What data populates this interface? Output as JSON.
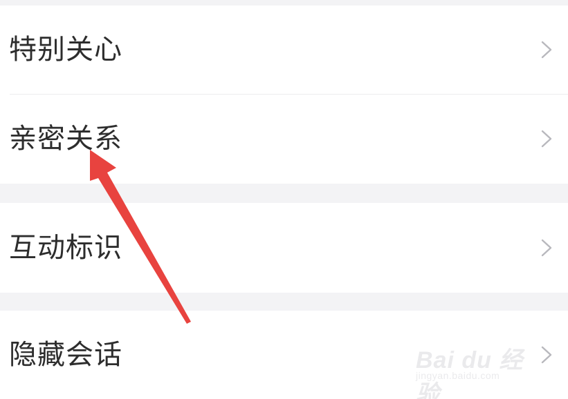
{
  "menu": {
    "groups": [
      {
        "items": [
          {
            "label": "特别关心",
            "icon": "chevron-right-icon"
          },
          {
            "label": "亲密关系",
            "icon": "chevron-right-icon"
          }
        ]
      },
      {
        "items": [
          {
            "label": "互动标识",
            "icon": "chevron-right-icon"
          }
        ]
      },
      {
        "items": [
          {
            "label": "隐藏会话",
            "icon": "chevron-right-icon"
          }
        ]
      }
    ]
  },
  "annotation": {
    "arrow_color": "#e8433f",
    "arrow_target": "亲密关系"
  },
  "watermark": {
    "brand": "Bai du 经验",
    "url": "jingyan.baidu.com"
  },
  "colors": {
    "background": "#f3f3f5",
    "card": "#ffffff",
    "text": "#2d2d2d",
    "chevron": "#b8b8bd",
    "divider": "#ececee"
  }
}
